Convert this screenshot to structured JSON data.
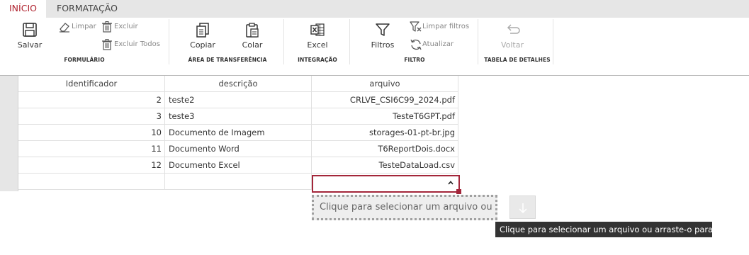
{
  "tabs": [
    {
      "label": "INÍCIO"
    },
    {
      "label": "FORMATAÇÃO"
    }
  ],
  "ribbon": {
    "formulario": {
      "label": "FORMULÁRIO",
      "salvar": "Salvar",
      "limpar": "Limpar",
      "excluir": "Excluir",
      "excluir_todos": "Excluir Todos"
    },
    "transferencia": {
      "label": "ÁREA DE TRANSFERÊNCIA",
      "copiar": "Copiar",
      "colar": "Colar"
    },
    "integracao": {
      "label": "INTEGRAÇÃO",
      "excel": "Excel"
    },
    "filtro": {
      "label": "FILTRO",
      "filtros": "Filtros",
      "limpar_filtros": "Limpar filtros",
      "atualizar": "Atualizar"
    },
    "detalhes": {
      "label": "TABELA DE DETALHES",
      "voltar": "Voltar"
    }
  },
  "grid": {
    "columns": [
      "Identificador",
      "descrição",
      "arquivo"
    ],
    "rows": [
      {
        "id": "2",
        "descricao": "teste2",
        "arquivo": "CRLVE_CSI6C99_2024.pdf"
      },
      {
        "id": "3",
        "descricao": "teste3",
        "arquivo": "TesteT6GPT.pdf"
      },
      {
        "id": "10",
        "descricao": "Documento de Imagem",
        "arquivo": "storages-01-pt-br.jpg"
      },
      {
        "id": "11",
        "descricao": "Documento Word",
        "arquivo": "T6ReportDois.docx"
      },
      {
        "id": "12",
        "descricao": "Documento Excel",
        "arquivo": "TesteDataLoad.csv"
      }
    ]
  },
  "upload": {
    "placeholder": "Clique para selecionar um arquivo ou ...",
    "tooltip": "Clique para selecionar um arquivo ou arraste-o para cá."
  },
  "colors": {
    "accent": "#b0232f",
    "editor_border": "#a3263a",
    "tooltip_bg": "#333333"
  }
}
